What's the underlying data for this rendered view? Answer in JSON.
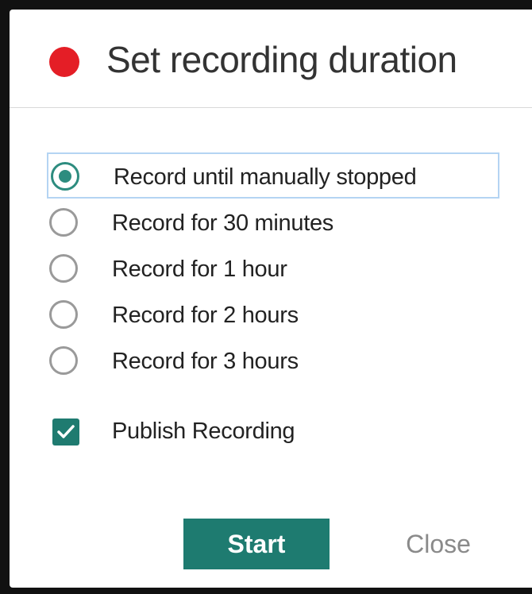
{
  "dialog": {
    "title": "Set recording duration",
    "accent_color": "#1e7b70",
    "record_indicator_color": "#e41e26",
    "options": [
      {
        "label": "Record until manually stopped",
        "selected": true
      },
      {
        "label": "Record for 30 minutes",
        "selected": false
      },
      {
        "label": "Record for 1 hour",
        "selected": false
      },
      {
        "label": "Record for 2 hours",
        "selected": false
      },
      {
        "label": "Record for 3 hours",
        "selected": false
      }
    ],
    "publish": {
      "label": "Publish Recording",
      "checked": true
    },
    "start_label": "Start",
    "close_label": "Close"
  }
}
